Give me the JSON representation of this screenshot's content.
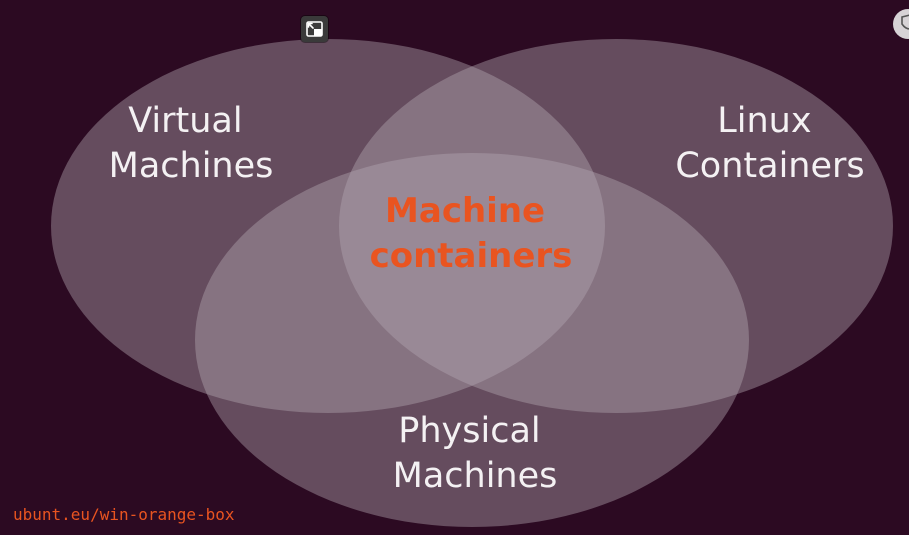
{
  "diagram": {
    "circles": [
      {
        "id": "virtual-machines",
        "lines": [
          "Virtual",
          "Machines"
        ]
      },
      {
        "id": "linux-containers",
        "lines": [
          "Linux",
          "Containers"
        ]
      },
      {
        "id": "physical-machines",
        "lines": [
          "Physical",
          "Machines"
        ]
      }
    ],
    "center": {
      "lines": [
        "Machine",
        "containers"
      ]
    }
  },
  "footer": {
    "url": "ubunt.eu/win-orange-box"
  },
  "colors": {
    "background": "#2c0a22",
    "circle_fill": "#b5aab2",
    "label_text": "#f4f1f3",
    "accent": "#e95420"
  },
  "icons": {
    "pip": "picture-in-picture-icon",
    "corner": "shield-icon"
  }
}
